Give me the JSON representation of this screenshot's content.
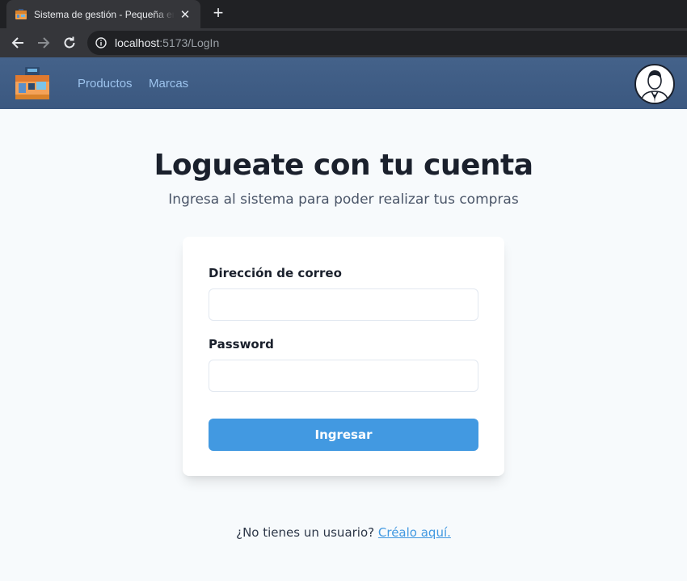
{
  "browser": {
    "tab_title": "Sistema de gestión - Pequeña empresa",
    "url_host": "localhost",
    "url_path": ":5173/LogIn"
  },
  "navbar": {
    "links": [
      "Productos",
      "Marcas"
    ]
  },
  "login": {
    "title": "Logueate con tu cuenta",
    "subtitle": "Ingresa al sistema para poder realizar tus compras",
    "email_label": "Dirección de correo",
    "email_value": "",
    "password_label": "Password",
    "password_value": "",
    "submit_label": "Ingresar",
    "signup_prompt": "¿No tienes un usuario?",
    "signup_link": "Créalo aquí."
  },
  "colors": {
    "navbar": "#3d5a80",
    "nav_link": "#9dc4ee",
    "accent": "#4299e1",
    "background": "#f7fafc"
  }
}
